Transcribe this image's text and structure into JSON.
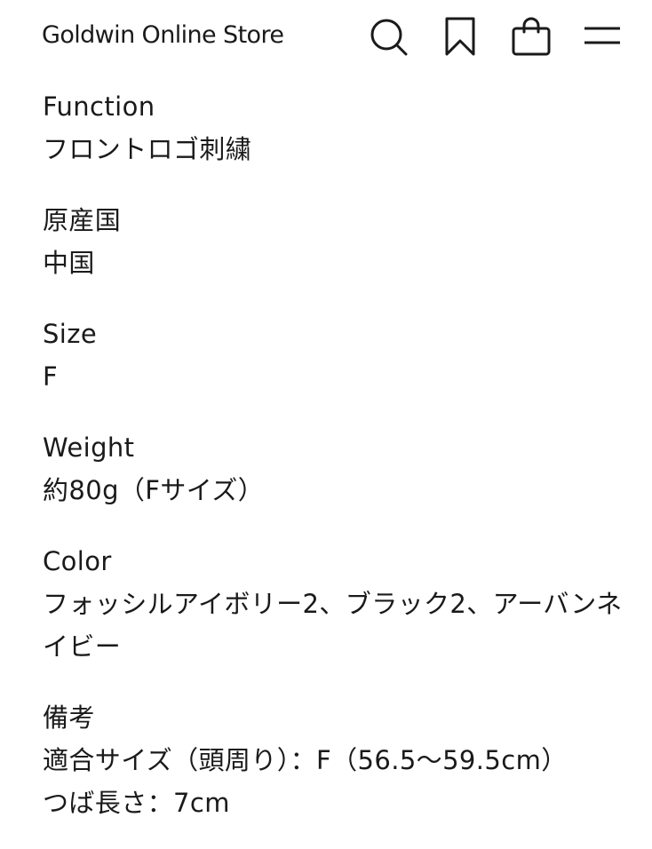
{
  "header": {
    "brand": "Goldwin Online Store",
    "icons": [
      "search-icon",
      "bookmark-icon",
      "bag-icon",
      "menu-icon"
    ]
  },
  "specs": [
    {
      "label": "Function",
      "value": "フロントロゴ刺繍"
    },
    {
      "label": "原産国",
      "value": "中国"
    },
    {
      "label": "Size",
      "value": "F"
    },
    {
      "label": "Weight",
      "value": "約80g（Fサイズ）"
    },
    {
      "label": "Color",
      "value": "フォッシルアイボリー2、ブラック2、アーバンネイビー"
    },
    {
      "label": "備考",
      "value": "適合サイズ（頭周り）：F（56.5〜59.5cm）\nつば長さ：7cm"
    }
  ]
}
